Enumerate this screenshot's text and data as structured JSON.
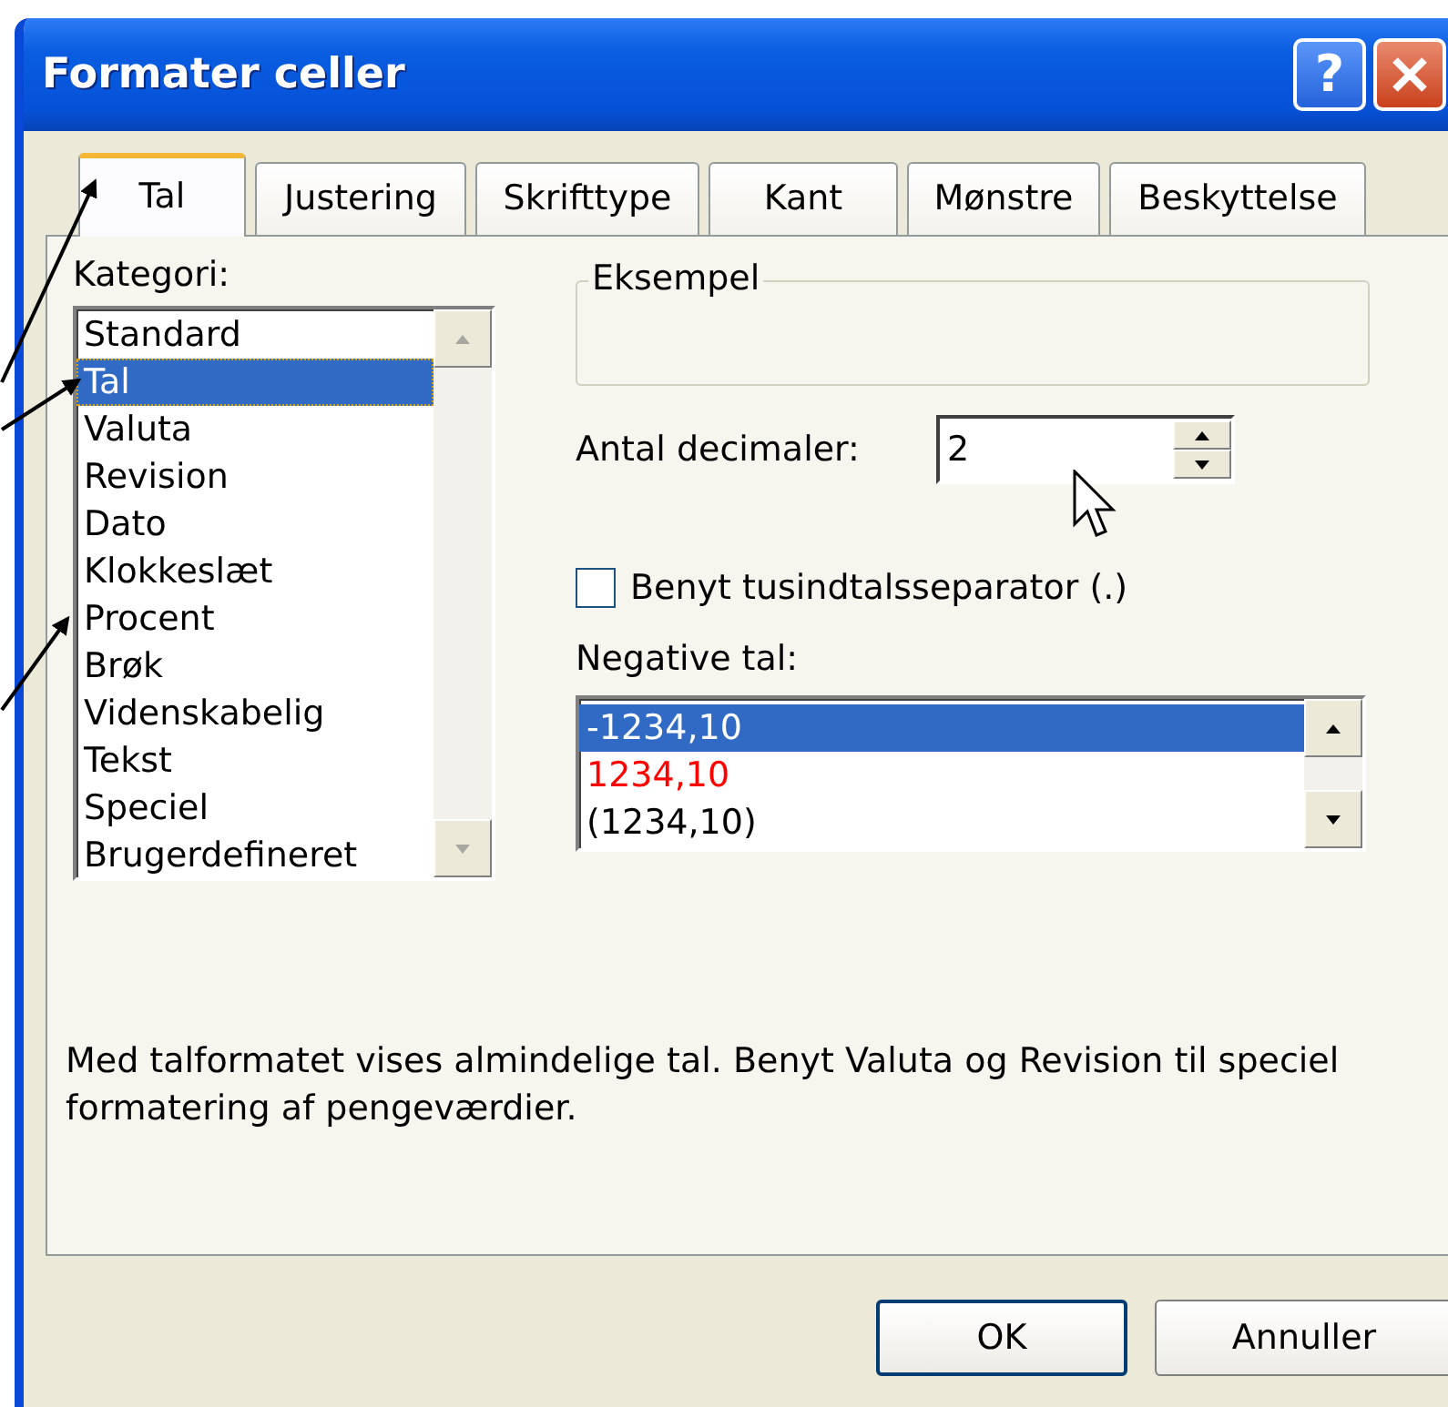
{
  "window": {
    "title": "Formater celler",
    "help_label": "?"
  },
  "tabs": [
    {
      "label": "Tal",
      "selected": true
    },
    {
      "label": "Justering",
      "selected": false
    },
    {
      "label": "Skrifttype",
      "selected": false
    },
    {
      "label": "Kant",
      "selected": false
    },
    {
      "label": "Mønstre",
      "selected": false
    },
    {
      "label": "Beskyttelse",
      "selected": false
    }
  ],
  "category": {
    "label": "Kategori:",
    "items": [
      {
        "label": "Standard",
        "selected": false
      },
      {
        "label": "Tal",
        "selected": true
      },
      {
        "label": "Valuta",
        "selected": false
      },
      {
        "label": "Revision",
        "selected": false
      },
      {
        "label": "Dato",
        "selected": false
      },
      {
        "label": "Klokkeslæt",
        "selected": false
      },
      {
        "label": "Procent",
        "selected": false
      },
      {
        "label": "Brøk",
        "selected": false
      },
      {
        "label": "Videnskabelig",
        "selected": false
      },
      {
        "label": "Tekst",
        "selected": false
      },
      {
        "label": "Speciel",
        "selected": false
      },
      {
        "label": "Brugerdefineret",
        "selected": false
      }
    ]
  },
  "sample": {
    "title": "Eksempel"
  },
  "decimals": {
    "label": "Antal decimaler:",
    "value": "2"
  },
  "thousands_separator": {
    "label": "Benyt tusindtalsseparator (.)",
    "checked": false
  },
  "negative_numbers": {
    "label": "Negative tal:",
    "items": [
      {
        "text": "-1234,10",
        "selected": true
      },
      {
        "text": "1234,10",
        "selected": false,
        "color": "#ff0000"
      },
      {
        "text": "(1234,10)",
        "selected": false,
        "color": "#000000"
      }
    ]
  },
  "description": "Med talformatet vises almindelige tal. Benyt Valuta og Revision til speciel formatering af pengeværdier.",
  "buttons": [
    {
      "label": "OK",
      "default": true
    },
    {
      "label": "Annuller",
      "default": false
    }
  ]
}
